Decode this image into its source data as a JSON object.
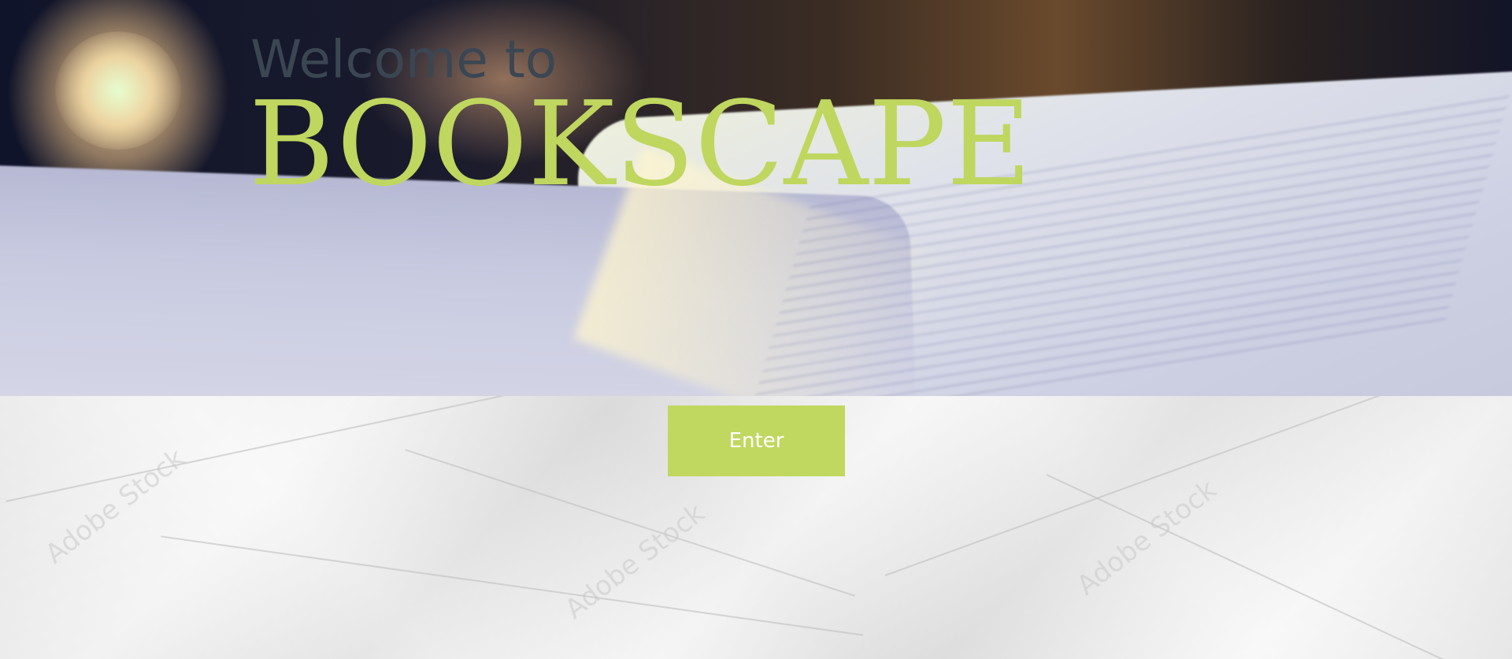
{
  "hero": {
    "welcome_text": "Welcome to",
    "brand_name": "BOOKSCAPE"
  },
  "actions": {
    "enter_label": "Enter"
  },
  "background": {
    "watermark_text": "Adobe Stock"
  },
  "colors": {
    "brand_green": "#bfd65f",
    "button_green": "#c0d860",
    "welcome_gray": "#3b4653",
    "paper": "#e9e9e9"
  }
}
